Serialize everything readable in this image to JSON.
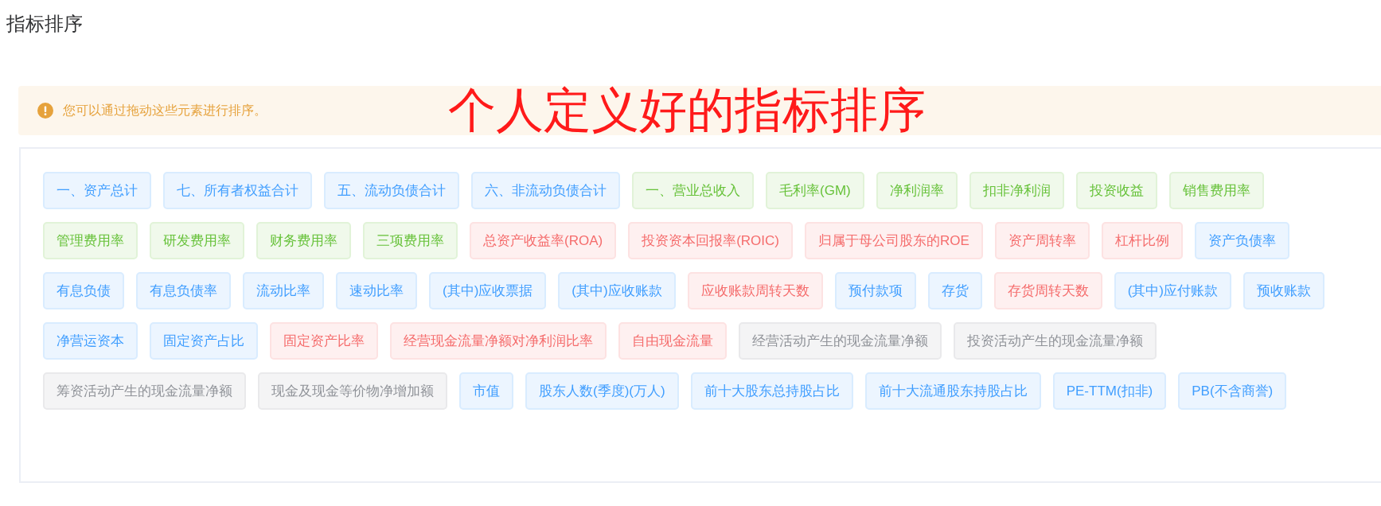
{
  "page_title": "指标排序",
  "alert": {
    "text": "您可以通过拖动这些元素进行排序。"
  },
  "annotation": "个人定义好的指标排序",
  "tag_rows": [
    [
      {
        "label": "一、资产总计",
        "kind": "primary"
      },
      {
        "label": "七、所有者权益合计",
        "kind": "primary"
      },
      {
        "label": "五、流动负债合计",
        "kind": "primary"
      },
      {
        "label": "六、非流动负债合计",
        "kind": "primary"
      },
      {
        "label": "一、营业总收入",
        "kind": "success"
      },
      {
        "label": "毛利率(GM)",
        "kind": "success"
      },
      {
        "label": "净利润率",
        "kind": "success"
      },
      {
        "label": "扣非净利润",
        "kind": "success"
      },
      {
        "label": "投资收益",
        "kind": "success"
      },
      {
        "label": "销售费用率",
        "kind": "success"
      }
    ],
    [
      {
        "label": "管理费用率",
        "kind": "success"
      },
      {
        "label": "研发费用率",
        "kind": "success"
      },
      {
        "label": "财务费用率",
        "kind": "success"
      },
      {
        "label": "三项费用率",
        "kind": "success"
      },
      {
        "label": "总资产收益率(ROA)",
        "kind": "danger"
      },
      {
        "label": "投资资本回报率(ROIC)",
        "kind": "danger"
      },
      {
        "label": "归属于母公司股东的ROE",
        "kind": "danger"
      },
      {
        "label": "资产周转率",
        "kind": "danger"
      },
      {
        "label": "杠杆比例",
        "kind": "danger"
      },
      {
        "label": "资产负债率",
        "kind": "primary"
      }
    ],
    [
      {
        "label": "有息负债",
        "kind": "primary"
      },
      {
        "label": "有息负债率",
        "kind": "primary"
      },
      {
        "label": "流动比率",
        "kind": "primary"
      },
      {
        "label": "速动比率",
        "kind": "primary"
      },
      {
        "label": "(其中)应收票据",
        "kind": "primary"
      },
      {
        "label": "(其中)应收账款",
        "kind": "primary"
      },
      {
        "label": "应收账款周转天数",
        "kind": "danger"
      },
      {
        "label": "预付款项",
        "kind": "primary"
      },
      {
        "label": "存货",
        "kind": "primary"
      },
      {
        "label": "存货周转天数",
        "kind": "danger"
      },
      {
        "label": "(其中)应付账款",
        "kind": "primary"
      },
      {
        "label": "预收账款",
        "kind": "primary"
      }
    ],
    [
      {
        "label": "净营运资本",
        "kind": "primary"
      },
      {
        "label": "固定资产占比",
        "kind": "primary"
      },
      {
        "label": "固定资产比率",
        "kind": "danger"
      },
      {
        "label": "经营现金流量净额对净利润比率",
        "kind": "danger"
      },
      {
        "label": "自由现金流量",
        "kind": "danger"
      },
      {
        "label": "经营活动产生的现金流量净额",
        "kind": "info"
      },
      {
        "label": "投资活动产生的现金流量净额",
        "kind": "info"
      }
    ],
    [
      {
        "label": "筹资活动产生的现金流量净额",
        "kind": "info"
      },
      {
        "label": "现金及现金等价物净增加额",
        "kind": "info"
      },
      {
        "label": "市值",
        "kind": "primary"
      },
      {
        "label": "股东人数(季度)(万人)",
        "kind": "primary"
      },
      {
        "label": "前十大股东总持股占比",
        "kind": "primary"
      },
      {
        "label": "前十大流通股东持股占比",
        "kind": "primary"
      },
      {
        "label": "PE-TTM(扣非)",
        "kind": "primary"
      },
      {
        "label": "PB(不含商誉)",
        "kind": "primary"
      }
    ]
  ]
}
